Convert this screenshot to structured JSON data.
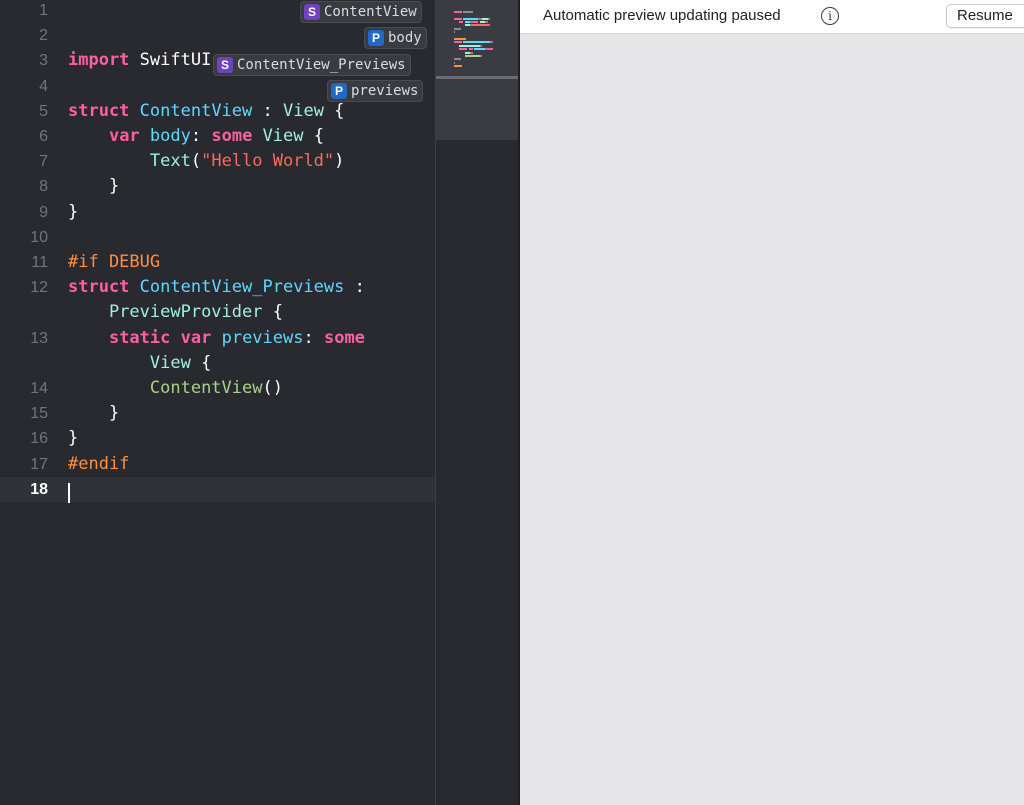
{
  "editor": {
    "current_line": 18,
    "lines": [
      {
        "n": "1",
        "tokens": []
      },
      {
        "n": "2",
        "tokens": []
      },
      {
        "n": "3",
        "tokens": [
          {
            "t": "import",
            "c": "keyword"
          },
          {
            "t": " ",
            "c": "plain"
          },
          {
            "t": "SwiftUI",
            "c": "plain"
          }
        ]
      },
      {
        "n": "4",
        "tokens": []
      },
      {
        "n": "5",
        "tokens": [
          {
            "t": "struct",
            "c": "keyword"
          },
          {
            "t": " ",
            "c": "plain"
          },
          {
            "t": "ContentView",
            "c": "type"
          },
          {
            "t": " : ",
            "c": "plain"
          },
          {
            "t": "View",
            "c": "apitype"
          },
          {
            "t": " {",
            "c": "plain"
          }
        ]
      },
      {
        "n": "6",
        "tokens": [
          {
            "t": "    ",
            "c": "plain"
          },
          {
            "t": "var",
            "c": "keyword"
          },
          {
            "t": " ",
            "c": "plain"
          },
          {
            "t": "body",
            "c": "type"
          },
          {
            "t": ": ",
            "c": "plain"
          },
          {
            "t": "some",
            "c": "keyword"
          },
          {
            "t": " ",
            "c": "plain"
          },
          {
            "t": "View",
            "c": "apitype"
          },
          {
            "t": " {",
            "c": "plain"
          }
        ]
      },
      {
        "n": "7",
        "tokens": [
          {
            "t": "        ",
            "c": "plain"
          },
          {
            "t": "Text",
            "c": "apitype"
          },
          {
            "t": "(",
            "c": "plain"
          },
          {
            "t": "\"Hello World\"",
            "c": "string"
          },
          {
            "t": ")",
            "c": "plain"
          }
        ]
      },
      {
        "n": "8",
        "tokens": [
          {
            "t": "    }",
            "c": "plain"
          }
        ]
      },
      {
        "n": "9",
        "tokens": [
          {
            "t": "}",
            "c": "plain"
          }
        ]
      },
      {
        "n": "10",
        "tokens": []
      },
      {
        "n": "11",
        "tokens": [
          {
            "t": "#if DEBUG",
            "c": "preproc"
          }
        ]
      },
      {
        "n": "12",
        "tokens": [
          {
            "t": "struct",
            "c": "keyword"
          },
          {
            "t": " ",
            "c": "plain"
          },
          {
            "t": "ContentView_Previews",
            "c": "type"
          },
          {
            "t": " :",
            "c": "plain"
          }
        ]
      },
      {
        "n": "",
        "tokens": [
          {
            "t": "    ",
            "c": "plain"
          },
          {
            "t": "PreviewProvider",
            "c": "apitype"
          },
          {
            "t": " {",
            "c": "plain"
          }
        ]
      },
      {
        "n": "13",
        "tokens": [
          {
            "t": "    ",
            "c": "plain"
          },
          {
            "t": "static",
            "c": "keyword"
          },
          {
            "t": " ",
            "c": "plain"
          },
          {
            "t": "var",
            "c": "keyword"
          },
          {
            "t": " ",
            "c": "plain"
          },
          {
            "t": "previews",
            "c": "type"
          },
          {
            "t": ": ",
            "c": "plain"
          },
          {
            "t": "some",
            "c": "keyword"
          }
        ]
      },
      {
        "n": "",
        "tokens": [
          {
            "t": "        ",
            "c": "plain"
          },
          {
            "t": "View",
            "c": "apitype"
          },
          {
            "t": " {",
            "c": "plain"
          }
        ]
      },
      {
        "n": "14",
        "tokens": [
          {
            "t": "        ",
            "c": "plain"
          },
          {
            "t": "ContentView",
            "c": "func"
          },
          {
            "t": "()",
            "c": "plain"
          }
        ]
      },
      {
        "n": "15",
        "tokens": [
          {
            "t": "    }",
            "c": "plain"
          }
        ]
      },
      {
        "n": "16",
        "tokens": [
          {
            "t": "}",
            "c": "plain"
          }
        ]
      },
      {
        "n": "17",
        "tokens": [
          {
            "t": "#endif",
            "c": "preproc"
          }
        ]
      },
      {
        "n": "18",
        "tokens": []
      }
    ]
  },
  "structure_popups": [
    {
      "kind": "S",
      "label": "ContentView"
    },
    {
      "kind": "P",
      "label": "body"
    },
    {
      "kind": "S",
      "label": "ContentView_Previews"
    },
    {
      "kind": "P",
      "label": "previews"
    }
  ],
  "preview": {
    "status_text": "Automatic preview updating paused",
    "resume_label": "Resume",
    "info_glyph": "i"
  },
  "colors": {
    "editor_bg": "#292a30",
    "keyword": "#fc5fa3",
    "type": "#5dd8ff",
    "string": "#fc6a5d",
    "preproc": "#fd8f3f",
    "canvas_bg": "#e5e5e8"
  }
}
